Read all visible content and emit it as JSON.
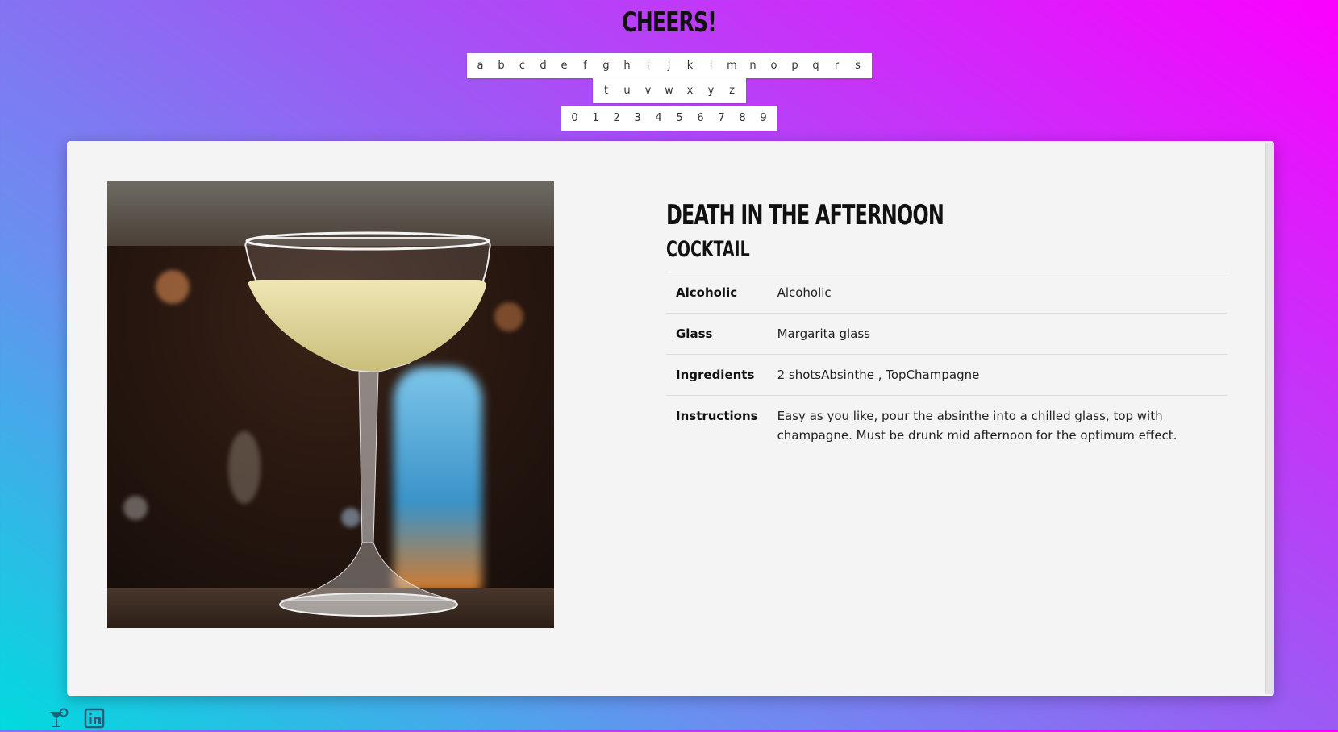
{
  "site": {
    "title": "CHEERS!"
  },
  "letters_row1": [
    "a",
    "b",
    "c",
    "d",
    "e",
    "f",
    "g",
    "h",
    "i",
    "j",
    "k",
    "l",
    "m",
    "n",
    "o",
    "p",
    "q",
    "r",
    "s"
  ],
  "letters_row2": [
    "t",
    "u",
    "v",
    "w",
    "x",
    "y",
    "z"
  ],
  "digits": [
    "0",
    "1",
    "2",
    "3",
    "4",
    "5",
    "6",
    "7",
    "8",
    "9"
  ],
  "drink": {
    "name": "DEATH IN THE AFTERNOON",
    "category": "COCKTAIL",
    "photo_alt": "Death in the Afternoon cocktail in a coupe glass",
    "rows": [
      {
        "key": "Alcoholic",
        "value": "Alcoholic"
      },
      {
        "key": "Glass",
        "value": "Margarita glass"
      },
      {
        "key": "Ingredients",
        "value": "2 shotsAbsinthe , TopChampagne"
      },
      {
        "key": "Instructions",
        "value": "Easy as you like, pour the absinthe into a chilled glass, top with champagne. Must be drunk mid afternoon for the optimum effect."
      }
    ]
  },
  "footer": {
    "icons": [
      "cocktail-icon",
      "linkedin-icon"
    ]
  },
  "colors": {
    "gradient_start": "#00dbde",
    "gradient_end": "#fc00ff",
    "card_bg": "#f4f4f4",
    "icon_color": "#1f5f7a"
  }
}
